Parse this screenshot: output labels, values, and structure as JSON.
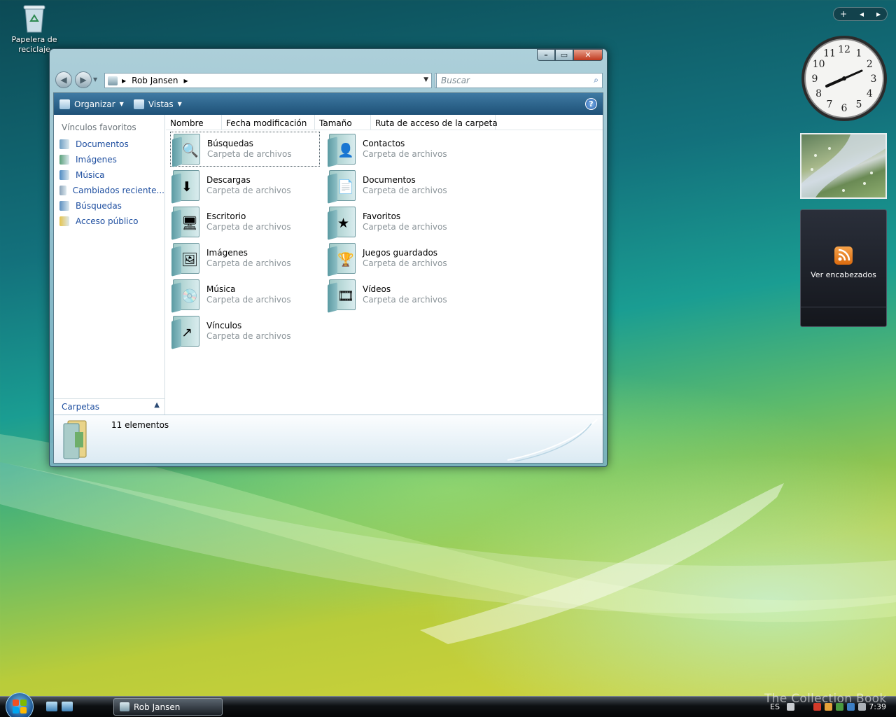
{
  "desktop": {
    "recycle_bin_label": "Papelera de reciclaje"
  },
  "window": {
    "address": {
      "location": "Rob Jansen"
    },
    "search": {
      "placeholder": "Buscar"
    },
    "toolbar": {
      "organize": "Organizar",
      "views": "Vistas",
      "help": "?"
    },
    "nav_pane": {
      "heading": "Vínculos favoritos",
      "items": [
        {
          "label": "Documentos",
          "icon": "documents-icon"
        },
        {
          "label": "Imágenes",
          "icon": "pictures-icon"
        },
        {
          "label": "Música",
          "icon": "music-icon"
        },
        {
          "label": "Cambiados reciente...",
          "icon": "recent-icon"
        },
        {
          "label": "Búsquedas",
          "icon": "searches-icon"
        },
        {
          "label": "Acceso público",
          "icon": "public-folder-icon"
        }
      ],
      "folders_label": "Carpetas"
    },
    "columns": [
      "Nombre",
      "Fecha modificación",
      "Tamaño",
      "Ruta de acceso de la carpeta"
    ],
    "items": [
      {
        "name": "Búsquedas",
        "type": "Carpeta de archivos",
        "icon": "searches-folder-icon",
        "selected": true
      },
      {
        "name": "Contactos",
        "type": "Carpeta de archivos",
        "icon": "contacts-folder-icon"
      },
      {
        "name": "Descargas",
        "type": "Carpeta de archivos",
        "icon": "downloads-folder-icon"
      },
      {
        "name": "Documentos",
        "type": "Carpeta de archivos",
        "icon": "documents-folder-icon"
      },
      {
        "name": "Escritorio",
        "type": "Carpeta de archivos",
        "icon": "desktop-folder-icon"
      },
      {
        "name": "Favoritos",
        "type": "Carpeta de archivos",
        "icon": "favorites-folder-icon"
      },
      {
        "name": "Imágenes",
        "type": "Carpeta de archivos",
        "icon": "pictures-folder-icon"
      },
      {
        "name": "Juegos guardados",
        "type": "Carpeta de archivos",
        "icon": "saved-games-folder-icon"
      },
      {
        "name": "Música",
        "type": "Carpeta de archivos",
        "icon": "music-folder-icon"
      },
      {
        "name": "Vídeos",
        "type": "Carpeta de archivos",
        "icon": "videos-folder-icon"
      },
      {
        "name": "Vínculos",
        "type": "Carpeta de archivos",
        "icon": "links-folder-icon"
      }
    ],
    "details": {
      "count_text": "11 elementos"
    }
  },
  "sidebar": {
    "controls": {
      "add": "+",
      "prev": "◂",
      "next": "▸"
    },
    "clock_numbers": [
      "12",
      "1",
      "2",
      "3",
      "4",
      "5",
      "6",
      "7",
      "8",
      "9",
      "10",
      "11"
    ],
    "feeds_label": "Ver encabezados"
  },
  "taskbar": {
    "task_label": "Rob Jansen",
    "language": "ES",
    "time": "7:39"
  },
  "watermark": "The Collection Book",
  "colors": {
    "link_blue": "#1f4fa0",
    "toolbar_blue": "#1e5177",
    "rss_orange": "#dc6b0e"
  }
}
